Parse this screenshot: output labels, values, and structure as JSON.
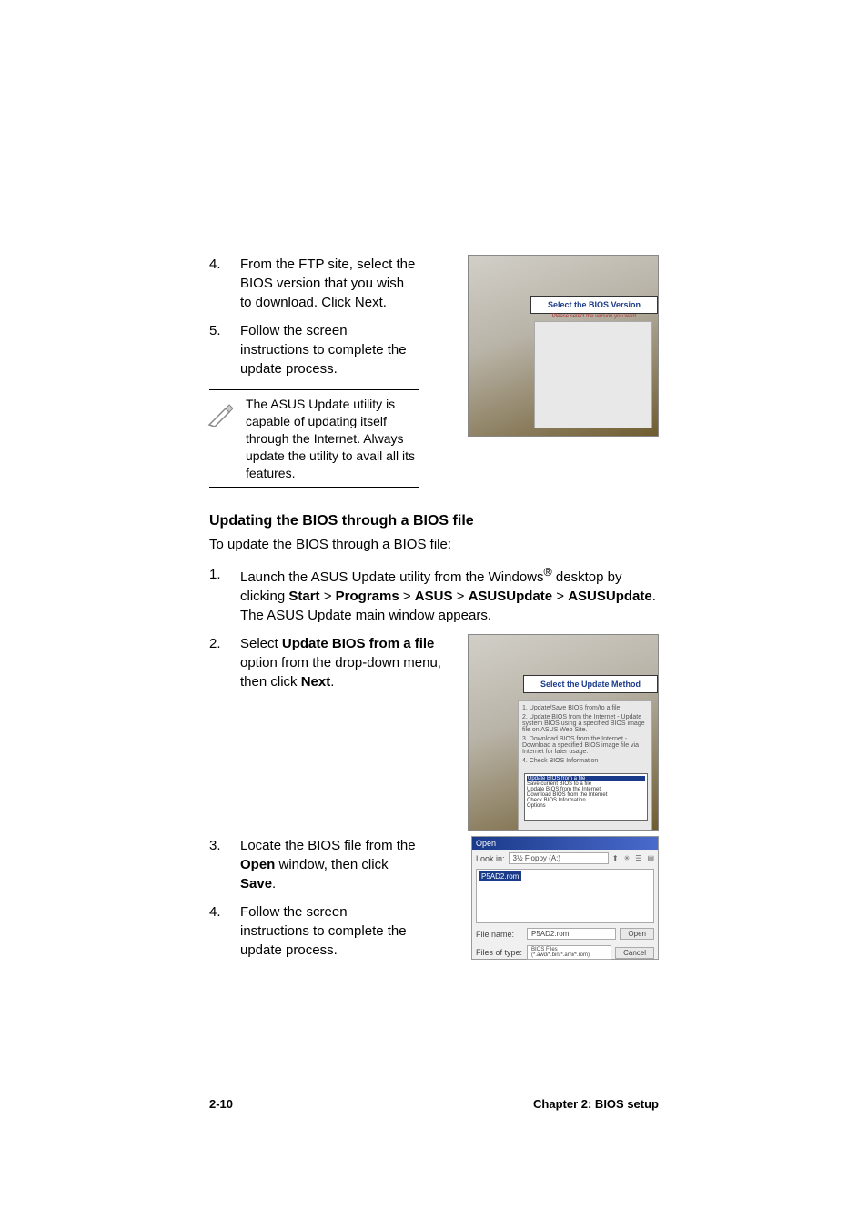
{
  "section1": {
    "items": [
      {
        "num": "4.",
        "text": "From the FTP site, select the BIOS version that you wish to download. Click Next."
      },
      {
        "num": "5.",
        "text": "Follow the screen instructions to complete the update process."
      }
    ],
    "note": "The ASUS Update utility is capable of updating itself through the Internet. Always update the utility to avail all its features.",
    "screenshot_title": "Select the BIOS Version",
    "screenshot_hint": "Please select the version you want"
  },
  "section2": {
    "heading": "Updating the BIOS through a BIOS file",
    "intro": "To update the BIOS through a BIOS file:",
    "step1_num": "1.",
    "step1_prefix": "Launch the ASUS Update utility from the Windows",
    "step1_reg": "®",
    "step1_mid": " desktop by clicking ",
    "step1_start": "Start",
    "step1_gt1": " > ",
    "step1_programs": "Programs",
    "step1_gt2": " > ",
    "step1_asus": "ASUS",
    "step1_gt3": " > ",
    "step1_asusupdate": "ASUSUpdate",
    "step1_gt4": " > ",
    "step1_asusupdate2": "ASUSUpdate",
    "step1_suffix": ". The ASUS Update main window appears.",
    "step2_num": "2.",
    "step2_prefix": "Select ",
    "step2_bold": "Update BIOS from a file",
    "step2_mid": " option from the drop-down menu, then click ",
    "step2_next": "Next",
    "step2_suffix": ".",
    "screenshot2_title": "Select the Update Method",
    "screenshot2_opts": [
      "1. Update/Save BIOS from/to a file.",
      "2. Update BIOS from the Internet - Update system BIOS using a specified BIOS image file on ASUS Web Site.",
      "3. Download BIOS from the Internet - Download a specified BIOS image file via Internet for later usage.",
      "4. Check BIOS Information"
    ],
    "dropdown_sel": "Update BIOS from a file",
    "dropdown_items": [
      "Save current BIOS to a file",
      "Update BIOS from the Internet",
      "Download BIOS from the Internet",
      "Check BIOS Information",
      "Options"
    ]
  },
  "section3": {
    "step3_num": "3.",
    "step3_prefix": "Locate the BIOS file from the ",
    "step3_open": "Open",
    "step3_mid": " window, then click ",
    "step3_save": "Save",
    "step3_suffix": ".",
    "step4_num": "4.",
    "step4_text": "Follow the screen instructions to complete the update process.",
    "dialog": {
      "title": "Open",
      "lookin_label": "Look in:",
      "lookin_value": "3½ Floppy (A:)",
      "file_item": "P5AD2.rom",
      "filename_label": "File name:",
      "filename_value": "P5AD2.rom",
      "filesoftype_label": "Files of type:",
      "filesoftype_value": "BIOS Files (*.awd/*.bin/*.ami/*.rom)",
      "open_btn": "Open",
      "cancel_btn": "Cancel"
    }
  },
  "footer": {
    "page": "2-10",
    "chapter": "Chapter 2: BIOS setup"
  }
}
